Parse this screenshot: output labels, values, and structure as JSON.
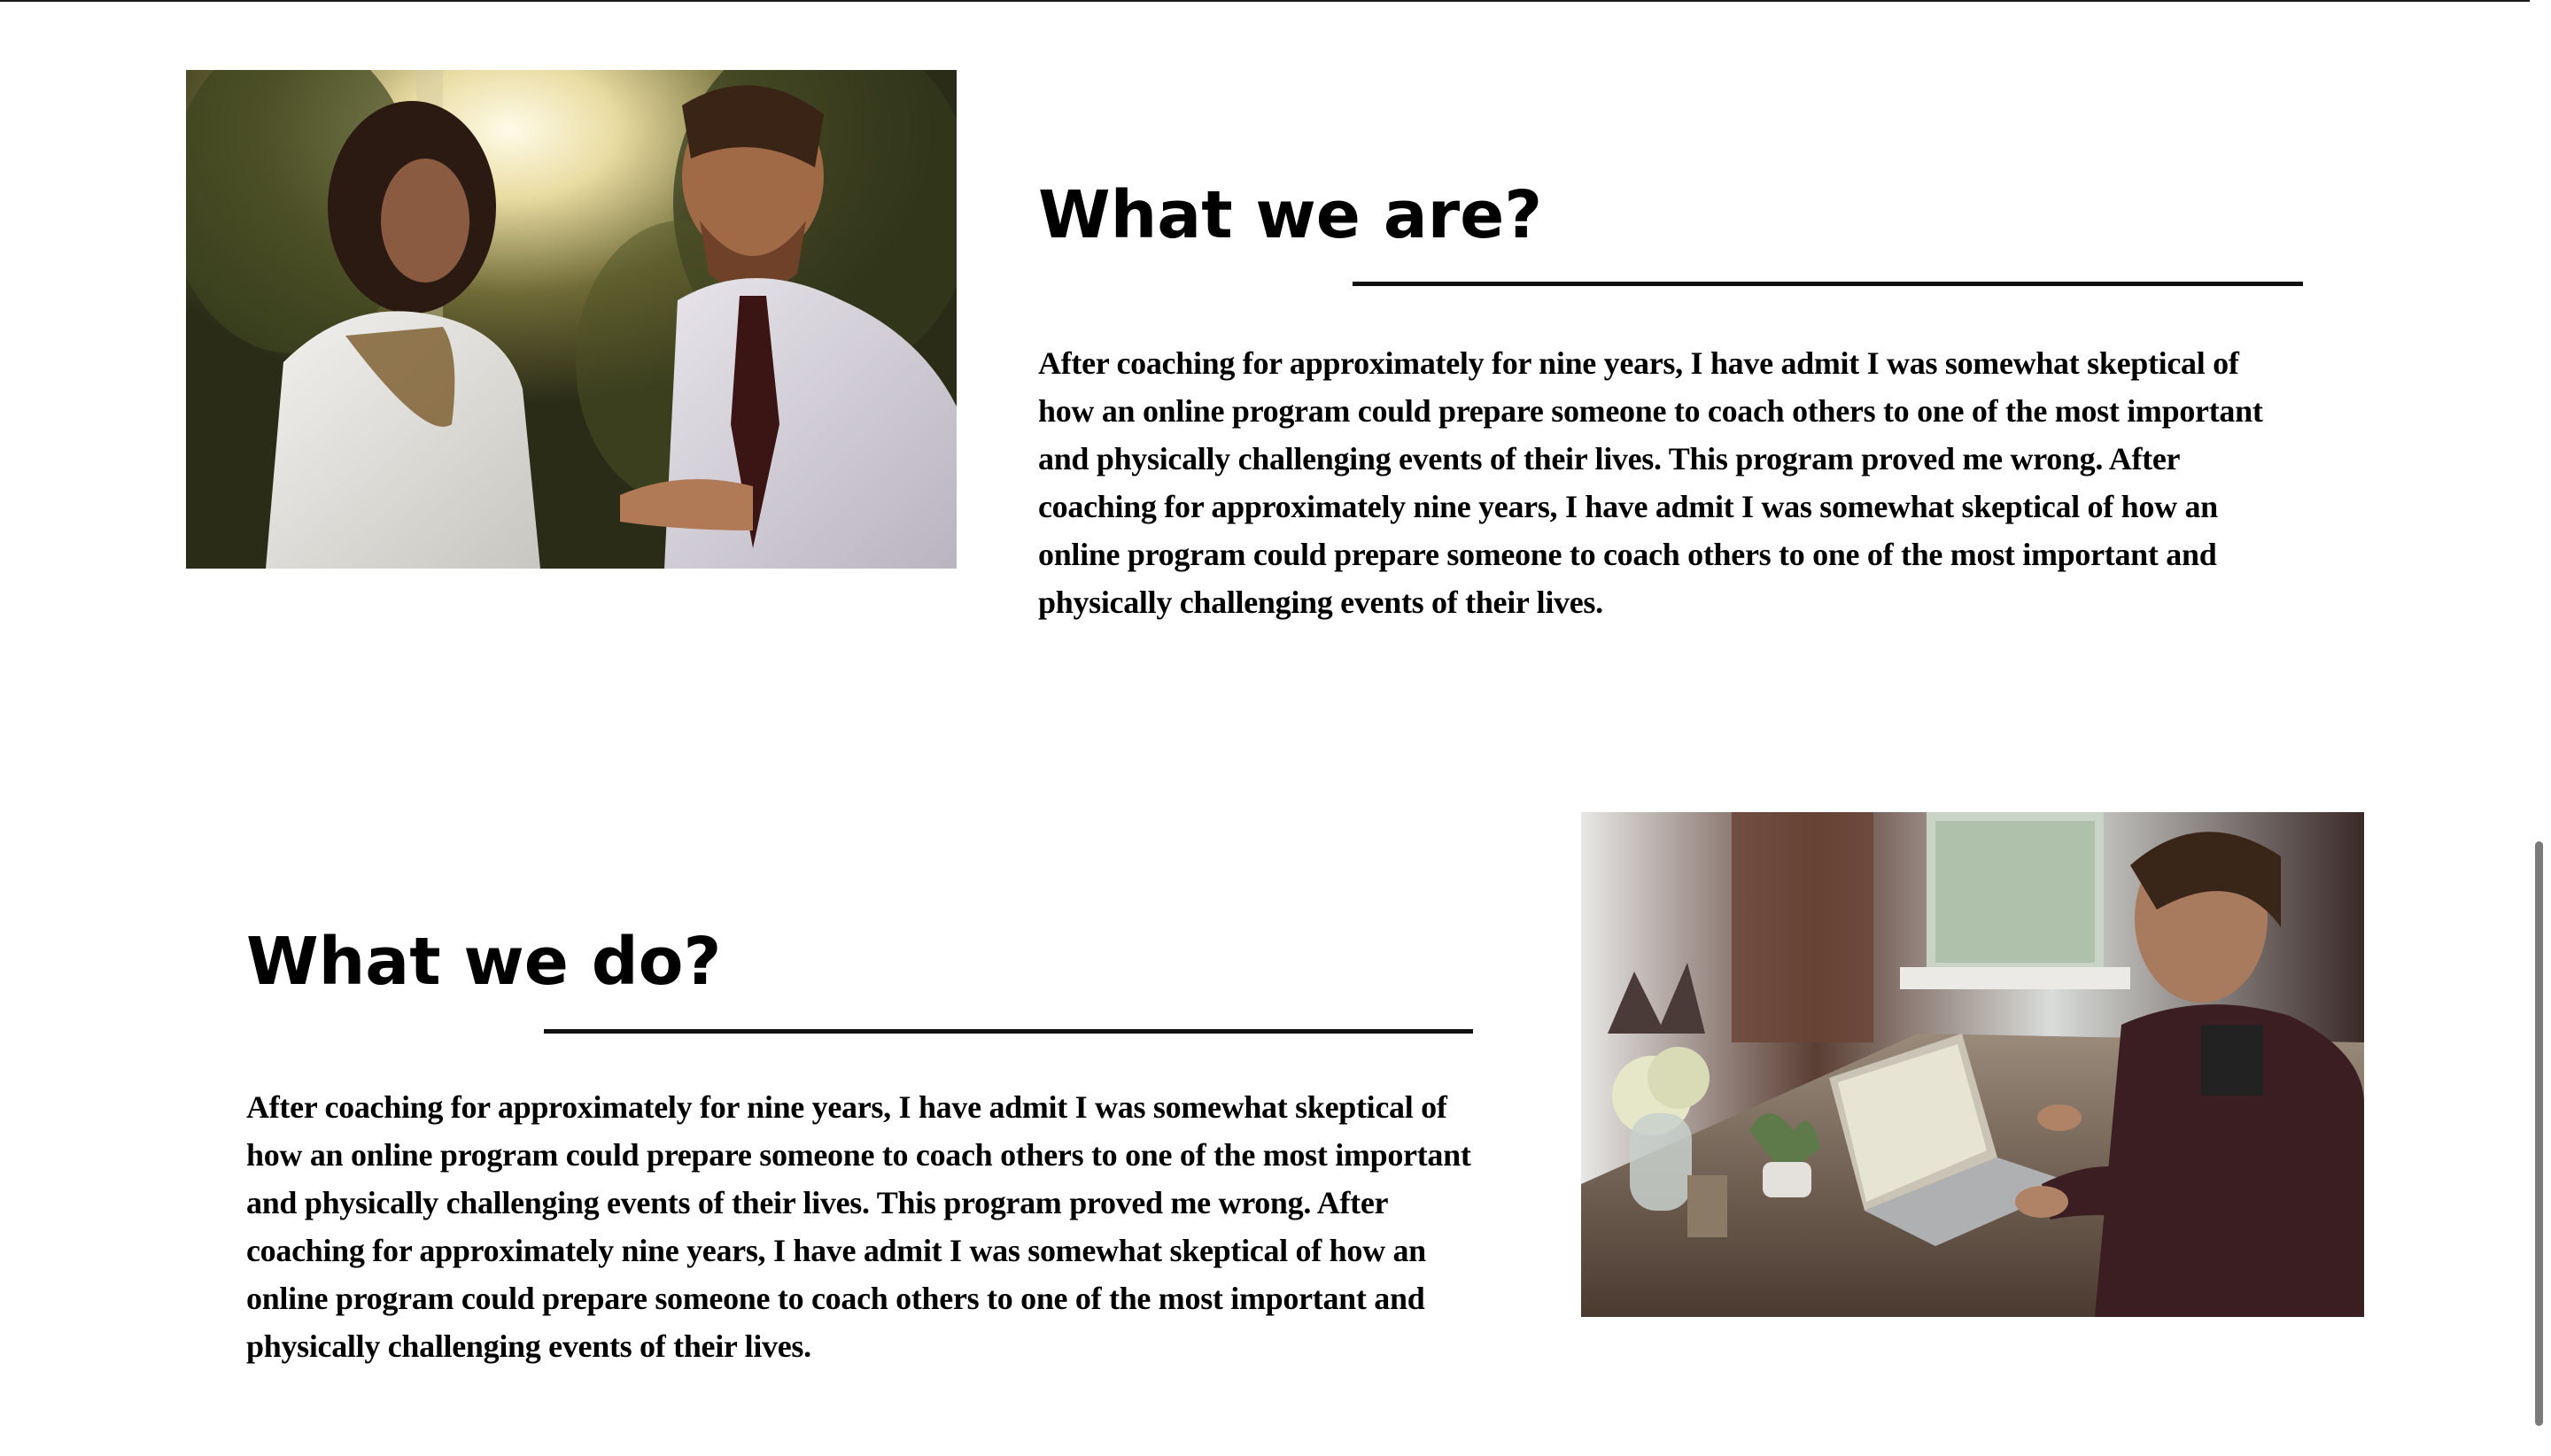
{
  "sections": [
    {
      "id": "about",
      "heading": "What we are?",
      "paragraph_lines": [
        "After coaching for approximately for nine years, I have admit I was somewhat skeptical of",
        "how an online program could prepare someone to coach others to one of the most important",
        "and physically challenging events of their lives. This program proved me wrong. After",
        "coaching for approximately nine years, I have admit I was somewhat skeptical of how an",
        "online program could prepare someone to coach others to one of the most important and",
        "physically challenging events of their lives."
      ],
      "image_icon": "photo-two-people-talking-outdoors"
    },
    {
      "id": "work",
      "heading": "What we do?",
      "paragraph_lines": [
        "After coaching for approximately for nine years, I have admit I was somewhat skeptical of",
        "how an online program could prepare someone to coach others to one of the most important",
        "and physically challenging events of their lives. This program proved me wrong. After",
        "coaching for approximately nine years, I have admit I was somewhat skeptical of how an",
        "online program could prepare someone to coach others to one of the most important and",
        "physically challenging events of their lives."
      ],
      "image_icon": "photo-man-working-on-laptop"
    }
  ],
  "colors": {
    "text": "#000000",
    "rule": "#111111",
    "background": "#ffffff",
    "scrollbar_thumb": "#7a7a7a"
  }
}
